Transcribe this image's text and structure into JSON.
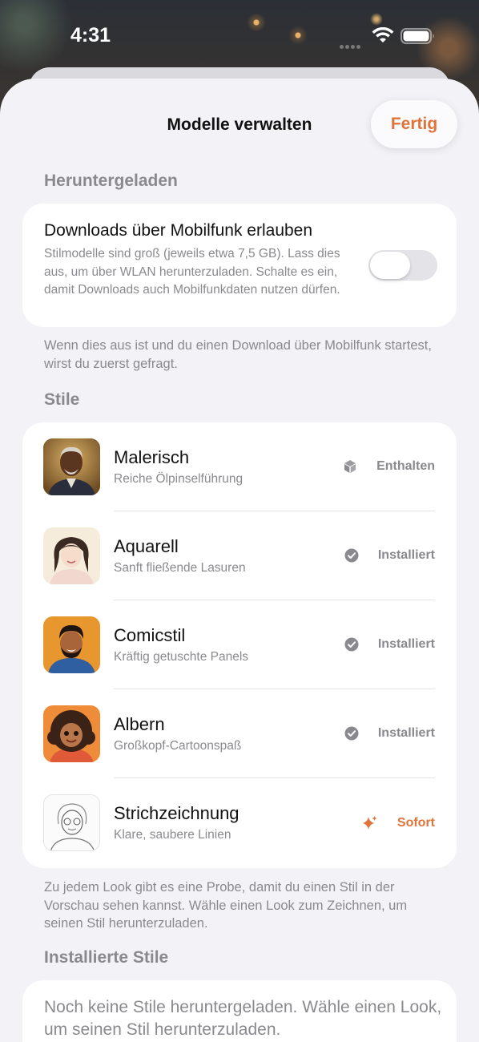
{
  "status_bar": {
    "time": "4:31"
  },
  "header": {
    "title": "Modelle verwalten",
    "done_label": "Fertig"
  },
  "downloaded_section": {
    "header": "Heruntergeladen",
    "cellular": {
      "title": "Downloads über Mobilfunk erlauben",
      "description": "Stilmodelle sind groß (jeweils etwa 7,5 GB). Lass dies aus, um über WLAN herunterzuladen. Schalte es ein, damit Downloads auch Mobilfunkdaten nutzen dürfen.",
      "enabled": false
    },
    "footnote": "Wenn dies aus ist und du einen Download über Mobilfunk startest, wirst du zuerst gefragt."
  },
  "styles_section": {
    "header": "Stile",
    "items": [
      {
        "name": "Malerisch",
        "subtitle": "Reiche Ölpinselführung",
        "status": "Enthalten",
        "status_icon": "cube-icon"
      },
      {
        "name": "Aquarell",
        "subtitle": "Sanft fließende Lasuren",
        "status": "Installiert",
        "status_icon": "check-circle-icon"
      },
      {
        "name": "Comicstil",
        "subtitle": "Kräftig getuschte Panels",
        "status": "Installiert",
        "status_icon": "check-circle-icon"
      },
      {
        "name": "Albern",
        "subtitle": "Großkopf-Cartoonspaß",
        "status": "Installiert",
        "status_icon": "check-circle-icon"
      },
      {
        "name": "Strichzeichnung",
        "subtitle": "Klare, saubere Linien",
        "status": "Sofort",
        "status_icon": "sparkle-icon"
      }
    ],
    "footnote": "Zu jedem Look gibt es eine Probe, damit du einen Stil in der Vorschau sehen kannst. Wähle einen Look zum Zeichnen, um seinen Stil herunterzuladen."
  },
  "installed_section": {
    "header": "Installierte Stile",
    "empty_text": "Noch keine Stile heruntergeladen. Wähle einen Look, um seinen Stil herunterzuladen."
  },
  "colors": {
    "accent": "#e0733a",
    "secondary_text": "#8a8a8e",
    "background": "#f2f2f7"
  }
}
